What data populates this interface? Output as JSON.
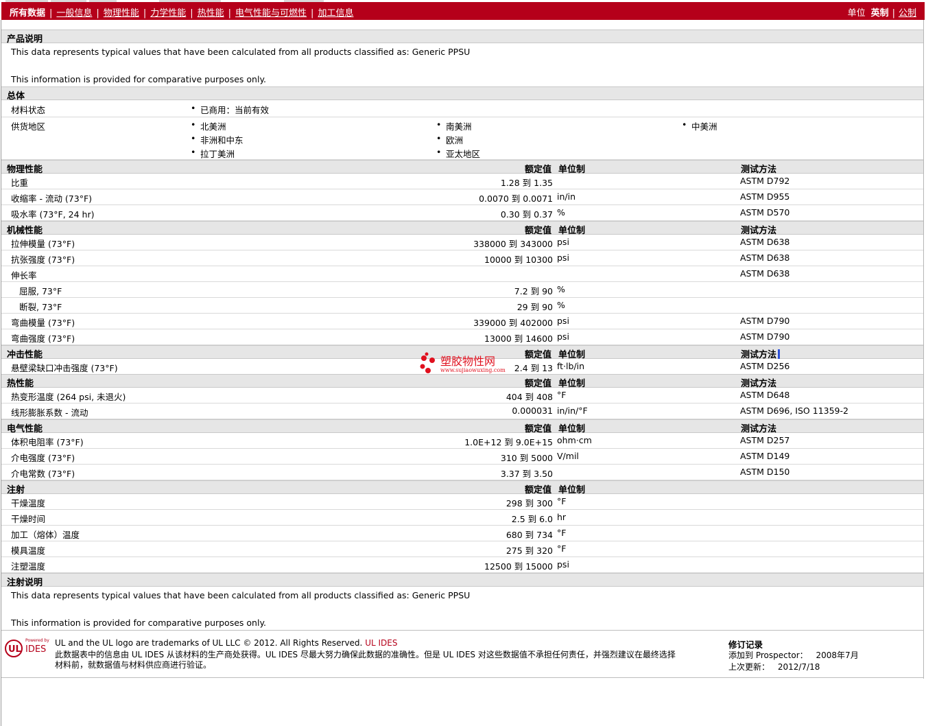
{
  "nav": {
    "tabs": [
      "所有数据",
      "一般信息",
      "物理性能",
      "力学性能",
      "热性能",
      "电气性能与可燃性",
      "加工信息"
    ],
    "units_label": "单位",
    "unit_english": "英制",
    "unit_metric": "公制"
  },
  "columns": {
    "nominal": "额定值",
    "unit": "单位制",
    "method": "测试方法"
  },
  "product_desc": {
    "title": "产品说明",
    "line1": "This data represents typical values that have been calculated from all products classified as: Generic PPSU",
    "line2": "This information is provided for comparative purposes only."
  },
  "general": {
    "title": "总体",
    "status_label": "材料状态",
    "status_value": "已商用：当前有效",
    "supply_label": "供货地区",
    "regions": [
      "北美洲",
      "非洲和中东",
      "拉丁美洲",
      "南美洲",
      "欧洲",
      "亚太地区",
      "中美洲"
    ]
  },
  "physical": {
    "title": "物理性能",
    "rows": [
      {
        "name": "比重",
        "value": "1.28 到  1.35",
        "unit": "",
        "method": "ASTM D792"
      },
      {
        "name": "收缩率  - 流动  (73°F)",
        "value": "0.0070 到  0.0071",
        "unit": "in/in",
        "method": "ASTM D955"
      },
      {
        "name": "吸水率  (73°F, 24 hr)",
        "value": "0.30 到  0.37",
        "unit": "%",
        "method": "ASTM D570"
      }
    ]
  },
  "mechanical": {
    "title": "机械性能",
    "rows": [
      {
        "name": "拉伸模量  (73°F)",
        "value": "338000 到  343000",
        "unit": "psi",
        "method": "ASTM D638"
      },
      {
        "name": "抗张强度  (73°F)",
        "value": "10000 到  10300",
        "unit": "psi",
        "method": "ASTM D638"
      },
      {
        "name": "伸长率",
        "value": "",
        "unit": "",
        "method": "ASTM D638"
      },
      {
        "name": "屈服, 73°F",
        "value": "7.2 到  90",
        "unit": "%",
        "method": ""
      },
      {
        "name": "断裂, 73°F",
        "value": "29 到  90",
        "unit": "%",
        "method": ""
      },
      {
        "name": "弯曲模量  (73°F)",
        "value": "339000 到  402000",
        "unit": "psi",
        "method": "ASTM D790"
      },
      {
        "name": "弯曲强度  (73°F)",
        "value": "13000 到  14600",
        "unit": "psi",
        "method": "ASTM D790"
      }
    ]
  },
  "impact": {
    "title": "冲击性能",
    "rows": [
      {
        "name": "悬壁梁缺口冲击强度  (73°F)",
        "value": "2.4 到  13",
        "unit": "ft·lb/in",
        "method": "ASTM D256"
      }
    ]
  },
  "thermal": {
    "title": "热性能",
    "rows": [
      {
        "name": "热变形温度  (264 psi, 未退火)",
        "value": "404 到  408",
        "unit": "°F",
        "method": "ASTM D648"
      },
      {
        "name": "线形膨胀系数  - 流动",
        "value": "0.000031",
        "unit": "in/in/°F",
        "method": "ASTM D696, ISO 11359-2"
      }
    ]
  },
  "electrical": {
    "title": "电气性能",
    "rows": [
      {
        "name": "体积电阻率  (73°F)",
        "value": "1.0E+12 到  9.0E+15",
        "unit": "ohm·cm",
        "method": "ASTM D257"
      },
      {
        "name": "介电强度  (73°F)",
        "value": "310 到  5000",
        "unit": "V/mil",
        "method": "ASTM D149"
      },
      {
        "name": "介电常数  (73°F)",
        "value": "3.37 到  3.50",
        "unit": "",
        "method": "ASTM D150"
      }
    ]
  },
  "injection": {
    "title": "注射",
    "rows": [
      {
        "name": "干燥温度",
        "value": "298 到  300",
        "unit": "°F",
        "method": ""
      },
      {
        "name": "干燥时间",
        "value": "2.5 到  6.0",
        "unit": "hr",
        "method": ""
      },
      {
        "name": "加工（熔体）温度",
        "value": "680 到  734",
        "unit": "°F",
        "method": ""
      },
      {
        "name": "模具温度",
        "value": "275 到  320",
        "unit": "°F",
        "method": ""
      },
      {
        "name": "注塑温度",
        "value": "12500 到  15000",
        "unit": "psi",
        "method": ""
      }
    ]
  },
  "injection_desc": {
    "title": "注射说明",
    "line1": "This data represents typical values that have been calculated from all products classified as: Generic PPSU",
    "line2": "This information is provided for comparative purposes only."
  },
  "watermark": {
    "cn": "塑胶物性网",
    "url": "www.sujiaowuxing.com"
  },
  "footer": {
    "trademark": "UL and the UL logo are trademarks of UL LLC © 2012. All Rights Reserved.",
    "ul_ides_link": "UL IDES",
    "disclaimer1": "此数据表中的信息由  UL IDES 从该材料的生产商处获得。UL IDES 尽最大努力确保此数据的准确性。但是  UL IDES 对这些数据值不承担任何责任，并强烈建议在最终选择",
    "disclaimer2": "材料前，就数据值与材料供应商进行验证。",
    "logo_powered": "Powered by",
    "logo_ul": "UL",
    "logo_ides": "IDES",
    "revision_title": "修订记录",
    "added_label": "添加到  Prospector：",
    "added_value": "2008年7月",
    "updated_label": "上次更新：",
    "updated_value": "2012/7/18"
  },
  "colors": {
    "brand_red": "#b5001a",
    "header_gray": "#e6e6e6",
    "cursor_blue": "#2b4fd8"
  }
}
